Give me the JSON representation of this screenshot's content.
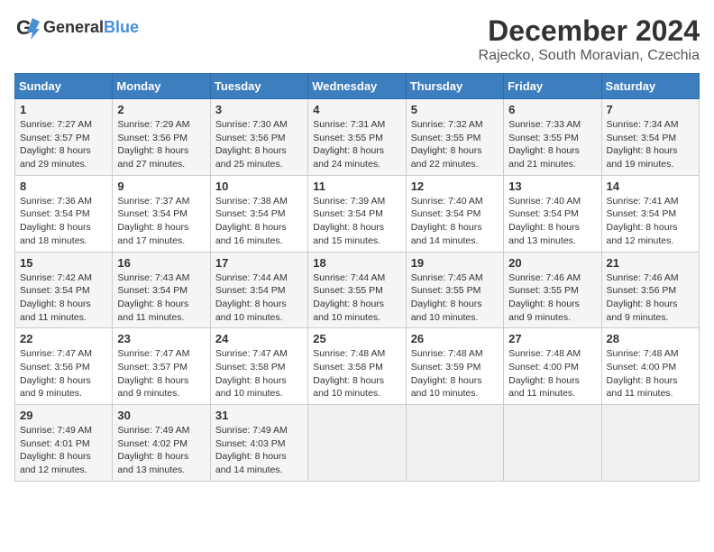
{
  "logo": {
    "general": "General",
    "blue": "Blue"
  },
  "header": {
    "month": "December 2024",
    "location": "Rajecko, South Moravian, Czechia"
  },
  "weekdays": [
    "Sunday",
    "Monday",
    "Tuesday",
    "Wednesday",
    "Thursday",
    "Friday",
    "Saturday"
  ],
  "weeks": [
    [
      {
        "day": "1",
        "sunrise": "Sunrise: 7:27 AM",
        "sunset": "Sunset: 3:57 PM",
        "daylight": "Daylight: 8 hours and 29 minutes."
      },
      {
        "day": "2",
        "sunrise": "Sunrise: 7:29 AM",
        "sunset": "Sunset: 3:56 PM",
        "daylight": "Daylight: 8 hours and 27 minutes."
      },
      {
        "day": "3",
        "sunrise": "Sunrise: 7:30 AM",
        "sunset": "Sunset: 3:56 PM",
        "daylight": "Daylight: 8 hours and 25 minutes."
      },
      {
        "day": "4",
        "sunrise": "Sunrise: 7:31 AM",
        "sunset": "Sunset: 3:55 PM",
        "daylight": "Daylight: 8 hours and 24 minutes."
      },
      {
        "day": "5",
        "sunrise": "Sunrise: 7:32 AM",
        "sunset": "Sunset: 3:55 PM",
        "daylight": "Daylight: 8 hours and 22 minutes."
      },
      {
        "day": "6",
        "sunrise": "Sunrise: 7:33 AM",
        "sunset": "Sunset: 3:55 PM",
        "daylight": "Daylight: 8 hours and 21 minutes."
      },
      {
        "day": "7",
        "sunrise": "Sunrise: 7:34 AM",
        "sunset": "Sunset: 3:54 PM",
        "daylight": "Daylight: 8 hours and 19 minutes."
      }
    ],
    [
      {
        "day": "8",
        "sunrise": "Sunrise: 7:36 AM",
        "sunset": "Sunset: 3:54 PM",
        "daylight": "Daylight: 8 hours and 18 minutes."
      },
      {
        "day": "9",
        "sunrise": "Sunrise: 7:37 AM",
        "sunset": "Sunset: 3:54 PM",
        "daylight": "Daylight: 8 hours and 17 minutes."
      },
      {
        "day": "10",
        "sunrise": "Sunrise: 7:38 AM",
        "sunset": "Sunset: 3:54 PM",
        "daylight": "Daylight: 8 hours and 16 minutes."
      },
      {
        "day": "11",
        "sunrise": "Sunrise: 7:39 AM",
        "sunset": "Sunset: 3:54 PM",
        "daylight": "Daylight: 8 hours and 15 minutes."
      },
      {
        "day": "12",
        "sunrise": "Sunrise: 7:40 AM",
        "sunset": "Sunset: 3:54 PM",
        "daylight": "Daylight: 8 hours and 14 minutes."
      },
      {
        "day": "13",
        "sunrise": "Sunrise: 7:40 AM",
        "sunset": "Sunset: 3:54 PM",
        "daylight": "Daylight: 8 hours and 13 minutes."
      },
      {
        "day": "14",
        "sunrise": "Sunrise: 7:41 AM",
        "sunset": "Sunset: 3:54 PM",
        "daylight": "Daylight: 8 hours and 12 minutes."
      }
    ],
    [
      {
        "day": "15",
        "sunrise": "Sunrise: 7:42 AM",
        "sunset": "Sunset: 3:54 PM",
        "daylight": "Daylight: 8 hours and 11 minutes."
      },
      {
        "day": "16",
        "sunrise": "Sunrise: 7:43 AM",
        "sunset": "Sunset: 3:54 PM",
        "daylight": "Daylight: 8 hours and 11 minutes."
      },
      {
        "day": "17",
        "sunrise": "Sunrise: 7:44 AM",
        "sunset": "Sunset: 3:54 PM",
        "daylight": "Daylight: 8 hours and 10 minutes."
      },
      {
        "day": "18",
        "sunrise": "Sunrise: 7:44 AM",
        "sunset": "Sunset: 3:55 PM",
        "daylight": "Daylight: 8 hours and 10 minutes."
      },
      {
        "day": "19",
        "sunrise": "Sunrise: 7:45 AM",
        "sunset": "Sunset: 3:55 PM",
        "daylight": "Daylight: 8 hours and 10 minutes."
      },
      {
        "day": "20",
        "sunrise": "Sunrise: 7:46 AM",
        "sunset": "Sunset: 3:55 PM",
        "daylight": "Daylight: 8 hours and 9 minutes."
      },
      {
        "day": "21",
        "sunrise": "Sunrise: 7:46 AM",
        "sunset": "Sunset: 3:56 PM",
        "daylight": "Daylight: 8 hours and 9 minutes."
      }
    ],
    [
      {
        "day": "22",
        "sunrise": "Sunrise: 7:47 AM",
        "sunset": "Sunset: 3:56 PM",
        "daylight": "Daylight: 8 hours and 9 minutes."
      },
      {
        "day": "23",
        "sunrise": "Sunrise: 7:47 AM",
        "sunset": "Sunset: 3:57 PM",
        "daylight": "Daylight: 8 hours and 9 minutes."
      },
      {
        "day": "24",
        "sunrise": "Sunrise: 7:47 AM",
        "sunset": "Sunset: 3:58 PM",
        "daylight": "Daylight: 8 hours and 10 minutes."
      },
      {
        "day": "25",
        "sunrise": "Sunrise: 7:48 AM",
        "sunset": "Sunset: 3:58 PM",
        "daylight": "Daylight: 8 hours and 10 minutes."
      },
      {
        "day": "26",
        "sunrise": "Sunrise: 7:48 AM",
        "sunset": "Sunset: 3:59 PM",
        "daylight": "Daylight: 8 hours and 10 minutes."
      },
      {
        "day": "27",
        "sunrise": "Sunrise: 7:48 AM",
        "sunset": "Sunset: 4:00 PM",
        "daylight": "Daylight: 8 hours and 11 minutes."
      },
      {
        "day": "28",
        "sunrise": "Sunrise: 7:48 AM",
        "sunset": "Sunset: 4:00 PM",
        "daylight": "Daylight: 8 hours and 11 minutes."
      }
    ],
    [
      {
        "day": "29",
        "sunrise": "Sunrise: 7:49 AM",
        "sunset": "Sunset: 4:01 PM",
        "daylight": "Daylight: 8 hours and 12 minutes."
      },
      {
        "day": "30",
        "sunrise": "Sunrise: 7:49 AM",
        "sunset": "Sunset: 4:02 PM",
        "daylight": "Daylight: 8 hours and 13 minutes."
      },
      {
        "day": "31",
        "sunrise": "Sunrise: 7:49 AM",
        "sunset": "Sunset: 4:03 PM",
        "daylight": "Daylight: 8 hours and 14 minutes."
      },
      null,
      null,
      null,
      null
    ]
  ]
}
